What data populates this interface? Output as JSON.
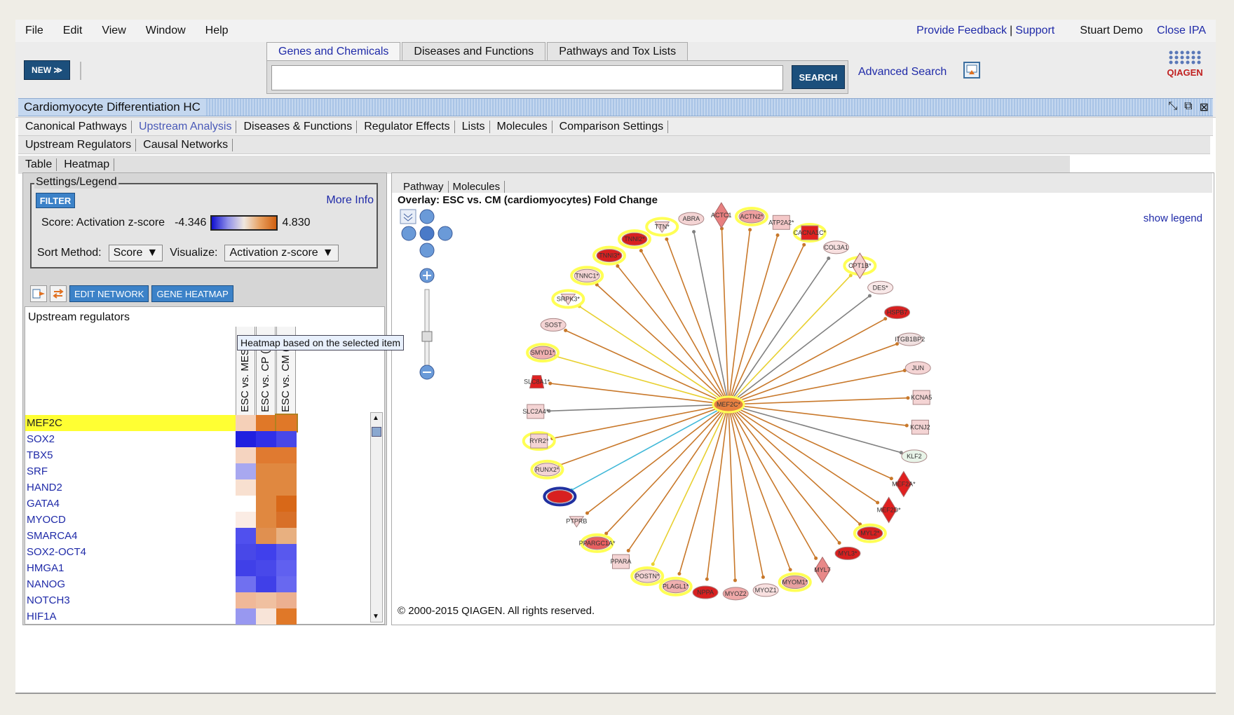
{
  "menu": {
    "items": [
      "File",
      "Edit",
      "View",
      "Window",
      "Help"
    ],
    "feedback": "Provide Feedback",
    "sep": "|",
    "support": "Support",
    "user": "Stuart Demo",
    "close": "Close IPA"
  },
  "toolbar": {
    "new_label": "NEW ≫",
    "search_tabs": [
      "Genes and Chemicals",
      "Diseases and Functions",
      "Pathways and Tox Lists"
    ],
    "search_button": "SEARCH",
    "advanced": "Advanced Search",
    "logo_text": "QIAGEN"
  },
  "window": {
    "title": "Cardiomyocyte Differentiation HC"
  },
  "tabs": {
    "analysis": [
      "Canonical Pathways",
      "Upstream Analysis",
      "Diseases & Functions",
      "Regulator Effects",
      "Lists",
      "Molecules",
      "Comparison Settings"
    ],
    "analysis_selected": 1,
    "upstream": [
      "Upstream Regulators",
      "Causal Networks"
    ],
    "view": [
      "Table",
      "Heatmap"
    ]
  },
  "settings": {
    "legend_title": "Settings/Legend",
    "filter": "FILTER",
    "more_info": "More Info",
    "score_label": "Score: Activation z-score",
    "min": "-4.346",
    "max": "4.830",
    "sort_label": "Sort Method:",
    "sort_value": "Score",
    "visualize_label": "Visualize:",
    "visualize_value": "Activation z-score"
  },
  "heatmap": {
    "edit_network": "EDIT NETWORK",
    "gene_heatmap": "GENE HEATMAP",
    "header": "Upstream regulators",
    "tooltip": "Heatmap based on the selected item",
    "columns": [
      "ESC vs. MES (n",
      "ESC vs. CP (pr",
      "ESC vs. CM (ca"
    ],
    "rows": [
      {
        "name": "MEF2C",
        "cells": [
          "#f5d0b8",
          "#e07828",
          "#e07828"
        ]
      },
      {
        "name": "SOX2",
        "cells": [
          "#2020e0",
          "#3030e8",
          "#4848e8"
        ]
      },
      {
        "name": "TBX5",
        "cells": [
          "#f5d4c0",
          "#e07a30",
          "#e07a30"
        ]
      },
      {
        "name": "SRF",
        "cells": [
          "#a8a8f0",
          "#e08840",
          "#e08840"
        ]
      },
      {
        "name": "HAND2",
        "cells": [
          "#f8e0d0",
          "#e08840",
          "#e08840"
        ]
      },
      {
        "name": "GATA4",
        "cells": [
          "#ffffff",
          "#e08840",
          "#d86818"
        ]
      },
      {
        "name": "MYOCD",
        "cells": [
          "#fbece4",
          "#e08840",
          "#d87028"
        ]
      },
      {
        "name": "SMARCA4",
        "cells": [
          "#5050ee",
          "#e09050",
          "#e8b080"
        ]
      },
      {
        "name": "SOX2-OCT4",
        "cells": [
          "#4848e8",
          "#4040ec",
          "#5858ee"
        ]
      },
      {
        "name": "HMGA1",
        "cells": [
          "#4040e8",
          "#4848ea",
          "#6060f0"
        ]
      },
      {
        "name": "NANOG",
        "cells": [
          "#7070f0",
          "#4040e8",
          "#6868f0"
        ]
      },
      {
        "name": "NOTCH3",
        "cells": [
          "#f0b898",
          "#f0c0a0",
          "#ecb090"
        ]
      },
      {
        "name": "HIF1A",
        "cells": [
          "#9898f0",
          "#f8e4d8",
          "#e07828"
        ]
      }
    ],
    "selected": 0
  },
  "pathway": {
    "tabs": [
      "Pathway",
      "Molecules"
    ],
    "overlay": "Overlay: ESC vs. CM (cardiomyocytes) Fold Change",
    "show_legend": "show legend",
    "copyright": "© 2000-2015 QIAGEN. All rights reserved.",
    "hub": "MEF2C*",
    "nodes": [
      {
        "label": "ACTN2*",
        "color": "#f0a0a0",
        "ring": "#ffff55",
        "shape": "ellipse"
      },
      {
        "label": "ATP2A2*",
        "color": "#f4c8c8",
        "ring": "",
        "shape": "rect"
      },
      {
        "label": "CACNA1C*",
        "color": "#e02020",
        "ring": "#ffff55",
        "shape": "rect"
      },
      {
        "label": "COL3A1",
        "color": "#f8e0e0",
        "ring": "",
        "shape": "ellipse"
      },
      {
        "label": "CPT1B*",
        "color": "#f4d0d0",
        "ring": "#ffff55",
        "shape": "diamond"
      },
      {
        "label": "DES*",
        "color": "#f8e8e8",
        "ring": "",
        "shape": "ellipse"
      },
      {
        "label": "HSPB7",
        "color": "#d82020",
        "ring": "",
        "shape": "ellipse"
      },
      {
        "label": "ITGB1BP2",
        "color": "#f0e0e0",
        "ring": "",
        "shape": "ellipse"
      },
      {
        "label": "JUN",
        "color": "#f4d4d4",
        "ring": "",
        "shape": "ellipse"
      },
      {
        "label": "KCNA5",
        "color": "#f4d4d4",
        "ring": "",
        "shape": "rect"
      },
      {
        "label": "KCNJ2",
        "color": "#f4d4d4",
        "ring": "",
        "shape": "rect"
      },
      {
        "label": "KLF2",
        "color": "#e8f4e8",
        "ring": "",
        "shape": "ellipse"
      },
      {
        "label": "MEF2A*",
        "color": "#e02020",
        "ring": "",
        "shape": "diamond"
      },
      {
        "label": "MEF2D*",
        "color": "#e02020",
        "ring": "",
        "shape": "diamond"
      },
      {
        "label": "MYL2*",
        "color": "#d82020",
        "ring": "#ffff55",
        "shape": "ellipse"
      },
      {
        "label": "MYL3*",
        "color": "#d82020",
        "ring": "",
        "shape": "ellipse"
      },
      {
        "label": "MYL7",
        "color": "#e88888",
        "ring": "",
        "shape": "diamond"
      },
      {
        "label": "MYOM1*",
        "color": "#e8a0a0",
        "ring": "#ffff55",
        "shape": "ellipse"
      },
      {
        "label": "MYOZ1",
        "color": "#f8e0e0",
        "ring": "",
        "shape": "ellipse"
      },
      {
        "label": "MYOZ2",
        "color": "#f0a8a8",
        "ring": "",
        "shape": "ellipse"
      },
      {
        "label": "NPPA",
        "color": "#d82020",
        "ring": "",
        "shape": "ellipse"
      },
      {
        "label": "PLAGL1*",
        "color": "#f0b0b0",
        "ring": "#ffff55",
        "shape": "ellipse"
      },
      {
        "label": "POSTN*",
        "color": "#f4d4d4",
        "ring": "#ffff55",
        "shape": "ellipse"
      },
      {
        "label": "PPARA",
        "color": "#f4d4d4",
        "ring": "",
        "shape": "rect"
      },
      {
        "label": "PPARGC1A*",
        "color": "#e86060",
        "ring": "#ffff55",
        "shape": "ellipse"
      },
      {
        "label": "PTPRB",
        "color": "#f4d4d4",
        "ring": "",
        "shape": "triangle"
      },
      {
        "label": "",
        "color": "#d82020",
        "ring": "#2030a0",
        "shape": "ellipse"
      },
      {
        "label": "RUNX2*",
        "color": "#f4d4d4",
        "ring": "#ffff55",
        "shape": "ellipse"
      },
      {
        "label": "RYR2*",
        "color": "#f4d4d4",
        "ring": "#ffff55",
        "shape": "rect"
      },
      {
        "label": "SLC2A4*",
        "color": "#f4d4d4",
        "ring": "",
        "shape": "rect"
      },
      {
        "label": "SLC8A1*",
        "color": "#e02020",
        "ring": "",
        "shape": "trap"
      },
      {
        "label": "SMYD1*",
        "color": "#f0b0b0",
        "ring": "#ffff55",
        "shape": "ellipse"
      },
      {
        "label": "SOST",
        "color": "#f4d4d4",
        "ring": "",
        "shape": "ellipse"
      },
      {
        "label": "SRPK3*",
        "color": "#f4d4d4",
        "ring": "#ffff55",
        "shape": "triangle"
      },
      {
        "label": "TNNC1*",
        "color": "#f4d4d4",
        "ring": "#ffff55",
        "shape": "ellipse"
      },
      {
        "label": "TNNI3*",
        "color": "#d82020",
        "ring": "#ffff55",
        "shape": "ellipse"
      },
      {
        "label": "TNNI2*",
        "color": "#d82020",
        "ring": "#ffff55",
        "shape": "ellipse"
      },
      {
        "label": "TTN*",
        "color": "#f4d4d4",
        "ring": "#ffff55",
        "shape": "triangle"
      },
      {
        "label": "ABRA",
        "color": "#f4d4d4",
        "ring": "",
        "shape": "ellipse"
      },
      {
        "label": "ACTC1",
        "color": "#e88080",
        "ring": "",
        "shape": "diamond"
      }
    ],
    "edge_colors": {
      "up": "#c8782a",
      "inconsistent": "#e8d030",
      "neutral": "#808080",
      "down": "#40b8d8"
    }
  },
  "colors": {
    "accent": "#1f2aa8",
    "button": "#1c4f7c",
    "filter": "#3c82c8",
    "selection": "#ffff33"
  }
}
